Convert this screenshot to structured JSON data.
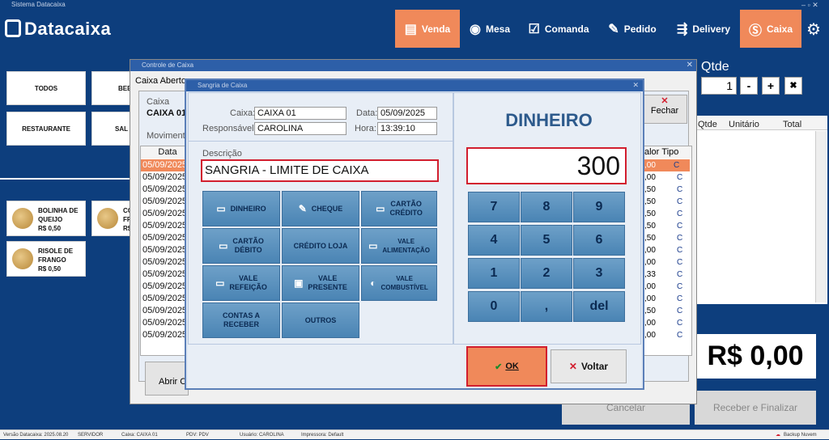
{
  "window": {
    "title": "Sistema Datacaixa",
    "controls": "– ▫ ✕"
  },
  "brand": {
    "name": "Datacaixa"
  },
  "nav": [
    {
      "label": "Venda",
      "icon": "register-icon"
    },
    {
      "label": "Mesa",
      "icon": "table-icon"
    },
    {
      "label": "Comanda",
      "icon": "clipboard-icon"
    },
    {
      "label": "Pedido",
      "icon": "notepad-icon"
    },
    {
      "label": "Delivery",
      "icon": "truck-icon"
    },
    {
      "label": "Caixa",
      "icon": "coin-icon"
    }
  ],
  "categories": [
    "TODOS",
    "BEB",
    "RESTAURANTE",
    "SAL"
  ],
  "products": [
    {
      "name1": "BOLINHA DE",
      "name2": "QUEIJO",
      "price": "R$ 0,50"
    },
    {
      "name1": "CO",
      "name2": "FR",
      "price": "R$"
    },
    {
      "name1": "RISOLE DE",
      "name2": "FRANGO",
      "price": "R$ 0,50"
    }
  ],
  "right": {
    "qtde_label": "Qtde",
    "qtde_value": "1",
    "minus": "-",
    "plus": "+",
    "trash": "✖",
    "col_qtde": "Qtde",
    "col_unit": "Unitário",
    "col_total": "Total",
    "total": "R$ 0,00",
    "cancelar": "Cancelar",
    "receber": "Receber e Finalizar"
  },
  "controle": {
    "title": "Controle de Caixa",
    "tab": "Caixa Aberto",
    "caixa_label": "Caixa",
    "caixa_value": "CAIXA 01",
    "mov_label": "Movimenta",
    "col_data": "Data",
    "col_valor": "alor",
    "col_tipo": "Tipo",
    "fechar": "Fechar",
    "abrir": "Abrir C",
    "dates": [
      "05/09/2025",
      "05/09/2025",
      "05/09/2025",
      "05/09/2025",
      "05/09/2025",
      "05/09/2025",
      "05/09/2025",
      "05/09/2025",
      "05/09/2025",
      "05/09/2025",
      "05/09/2025",
      "05/09/2025",
      "05/09/2025",
      "05/09/2025",
      "05/09/2025"
    ],
    "valores": [
      ",00",
      ",00",
      ",50",
      ",50",
      ",50",
      ",50",
      ",50",
      ",00",
      ",00",
      ",33",
      ",00",
      ",00",
      ",50",
      ",00",
      ",00"
    ],
    "tipos": [
      "C",
      "C",
      "C",
      "C",
      "C",
      "C",
      "C",
      "C",
      "C",
      "C",
      "C",
      "C",
      "C",
      "C",
      "C"
    ]
  },
  "sangria": {
    "title": "Sangria de Caixa",
    "caixa_label": "Caixa:",
    "caixa_value": "CAIXA 01",
    "resp_label": "Responsável:",
    "resp_value": "CAROLINA",
    "data_label": "Data:",
    "data_value": "05/09/2025",
    "hora_label": "Hora:",
    "hora_value": "13:39:10",
    "desc_label": "Descrição",
    "desc_value": "SANGRIA - LIMITE DE CAIXA",
    "payments": [
      [
        "DINHEIRO",
        ""
      ],
      [
        "CHEQUE",
        ""
      ],
      [
        "CARTÃO",
        "CRÉDITO"
      ],
      [
        "CARTÃO",
        "DÉBITO"
      ],
      [
        "CRÉDITO LOJA",
        ""
      ],
      [
        "VALE",
        "ALIMENTAÇÃO"
      ],
      [
        "VALE",
        "REFEIÇÃO"
      ],
      [
        "VALE",
        "PRESENTE"
      ],
      [
        "VALE",
        "COMBUSTÍVEL"
      ],
      [
        "CONTAS A",
        "RECEBER"
      ],
      [
        "OUTROS",
        ""
      ]
    ],
    "method": "DINHEIRO",
    "amount": "300",
    "keys": [
      "7",
      "8",
      "9",
      "4",
      "5",
      "6",
      "1",
      "2",
      "3",
      "0",
      ",",
      "del"
    ],
    "ok": "OK",
    "voltar": "Voltar"
  },
  "status": {
    "versao": "Versão Datacaixa: 2025.08.20",
    "servidor": "SERVIDOR",
    "caixa": "Caixa: CAIXA 01",
    "pdv": "PDV: PDV",
    "usuario": "Usuário: CAROLINA",
    "impressora": "Impressora: Default",
    "backup": "Backup Nuvem"
  }
}
